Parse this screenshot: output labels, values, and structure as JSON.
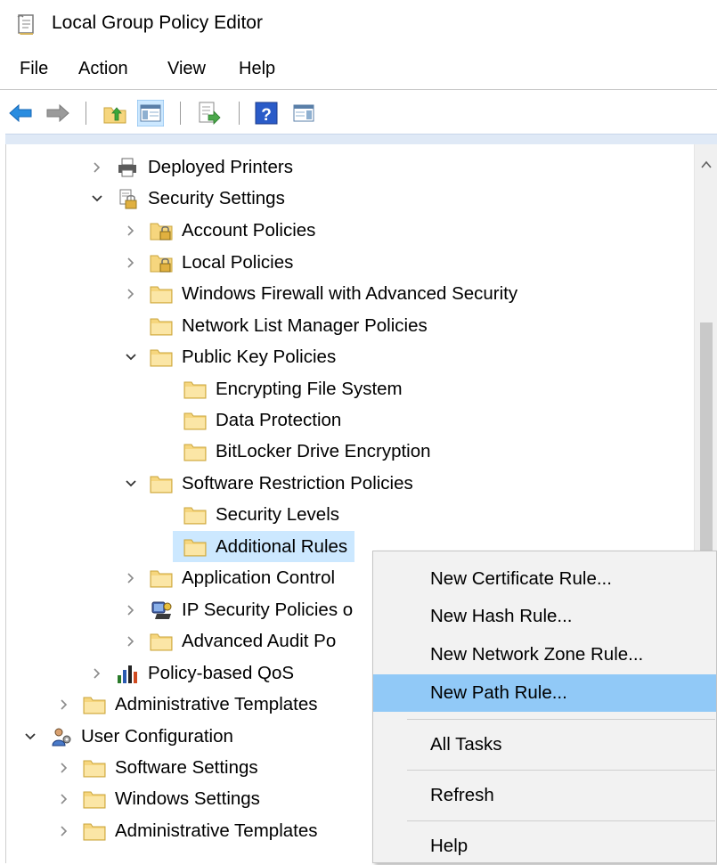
{
  "window": {
    "title": "Local Group Policy Editor",
    "app_icon": "policy-editor-icon"
  },
  "menubar": {
    "file": "File",
    "action": "Action",
    "view": "View",
    "help": "Help"
  },
  "toolbar": {
    "buttons": [
      "back-arrow-icon",
      "forward-arrow-icon",
      "up-folder-icon",
      "show-hide-console-tree-icon",
      "export-list-icon",
      "help-icon",
      "show-hide-action-pane-icon"
    ]
  },
  "tree": {
    "items": [
      {
        "label": "Deployed Printers",
        "icon": "printer-icon",
        "expander": "collapsed"
      },
      {
        "label": "Security Settings",
        "icon": "security-settings-icon",
        "expander": "expanded"
      },
      {
        "label": "Account Policies",
        "icon": "locked-folder-icon",
        "expander": "collapsed"
      },
      {
        "label": "Local Policies",
        "icon": "locked-folder-icon",
        "expander": "collapsed"
      },
      {
        "label": "Windows Firewall with Advanced Security",
        "icon": "folder-icon",
        "expander": "collapsed"
      },
      {
        "label": "Network List Manager Policies",
        "icon": "folder-icon",
        "expander": "none"
      },
      {
        "label": "Public Key Policies",
        "icon": "folder-icon",
        "expander": "expanded"
      },
      {
        "label": "Encrypting File System",
        "icon": "folder-icon",
        "expander": "none"
      },
      {
        "label": "Data Protection",
        "icon": "folder-icon",
        "expander": "none"
      },
      {
        "label": "BitLocker Drive Encryption",
        "icon": "folder-icon",
        "expander": "none"
      },
      {
        "label": "Software Restriction Policies",
        "icon": "folder-icon",
        "expander": "expanded"
      },
      {
        "label": "Security Levels",
        "icon": "folder-icon",
        "expander": "none"
      },
      {
        "label": "Additional Rules",
        "icon": "folder-icon",
        "expander": "none",
        "selected": true
      },
      {
        "label": "Application Control",
        "icon": "folder-icon",
        "expander": "collapsed"
      },
      {
        "label": "IP Security Policies o",
        "icon": "ip-security-icon",
        "expander": "collapsed"
      },
      {
        "label": "Advanced Audit Po",
        "icon": "folder-icon",
        "expander": "collapsed"
      },
      {
        "label": "Policy-based QoS",
        "icon": "qos-chart-icon",
        "expander": "collapsed"
      },
      {
        "label": "Administrative Templates",
        "icon": "folder-icon",
        "expander": "collapsed"
      },
      {
        "label": "User Configuration",
        "icon": "user-config-icon",
        "expander": "expanded"
      },
      {
        "label": "Software Settings",
        "icon": "folder-icon",
        "expander": "collapsed"
      },
      {
        "label": "Windows Settings",
        "icon": "folder-icon",
        "expander": "collapsed"
      },
      {
        "label": "Administrative Templates",
        "icon": "folder-icon",
        "expander": "collapsed"
      }
    ]
  },
  "context_menu": {
    "items": [
      {
        "label": "New Certificate Rule..."
      },
      {
        "label": "New Hash Rule..."
      },
      {
        "label": "New Network Zone Rule..."
      },
      {
        "label": "New Path Rule...",
        "highlighted": true
      },
      {
        "label": "All Tasks"
      },
      {
        "label": "Refresh"
      },
      {
        "label": "Help"
      }
    ]
  },
  "colors": {
    "selection": "#cce8ff",
    "menu_highlight": "#91c9f7",
    "menu_background": "#f2f2f2",
    "folder_fill": "#f6d67e",
    "arrow_blue": "#2a8de0"
  }
}
